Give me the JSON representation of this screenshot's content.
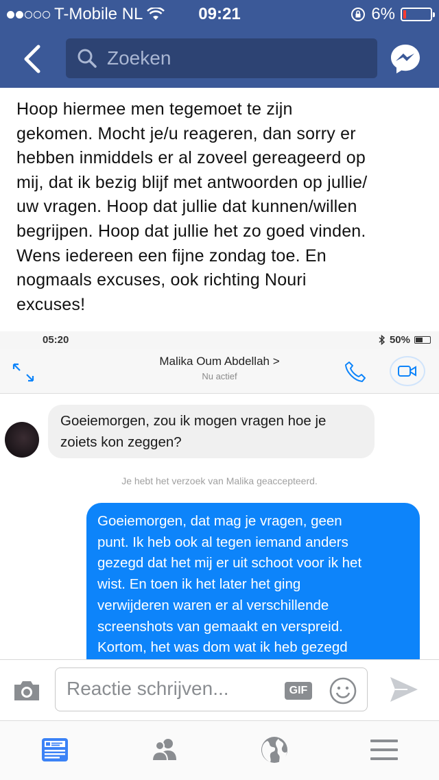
{
  "status_bar": {
    "carrier": "T-Mobile NL",
    "time": "09:21",
    "battery": "6%"
  },
  "nav": {
    "search_placeholder": "Zoeken"
  },
  "post": {
    "lines": [
      "Hoop hiermee men tegemoet te zijn",
      "gekomen. Mocht je/u reageren, dan sorry er",
      "hebben inmiddels er al zoveel gereageerd op",
      "mij, dat ik bezig blijf met antwoorden op jullie/",
      "uw vragen. Hoop dat jullie dat kunnen/willen",
      "begrijpen. Hoop dat jullie het zo goed vinden.",
      "Wens iedereen een fijne zondag toe. En",
      "nogmaals excuses, ook richting Nouri",
      "excuses!"
    ]
  },
  "screenshot": {
    "time": "05:20",
    "battery": "50%",
    "contact_name": "Malika Oum Abdellah >",
    "contact_status": "Nu actief",
    "incoming_lines": [
      "Goeiemorgen, zou ik mogen vragen hoe je",
      "zoiets kon zeggen?"
    ],
    "notice": "Je hebt het verzoek van Malika geaccepteerd.",
    "outgoing_lines": [
      "Goeiemorgen, dat mag je vragen, geen",
      "punt. Ik heb ook al tegen iemand anders",
      "gezegd dat het mij er uit schoot voor ik het",
      "wist. En toen ik het later het ging",
      "verwijderen waren er al verschillende",
      "screenshots van gemaakt en verspreid.",
      "Kortom, het was dom wat ik heb gezegd"
    ]
  },
  "comment_bar": {
    "placeholder": "Reactie schrijven...",
    "gif_label": "GIF"
  },
  "colors": {
    "facebook_blue": "#3b5998",
    "messenger_blue": "#0d84fa",
    "battery_low": "#ff3b30"
  }
}
